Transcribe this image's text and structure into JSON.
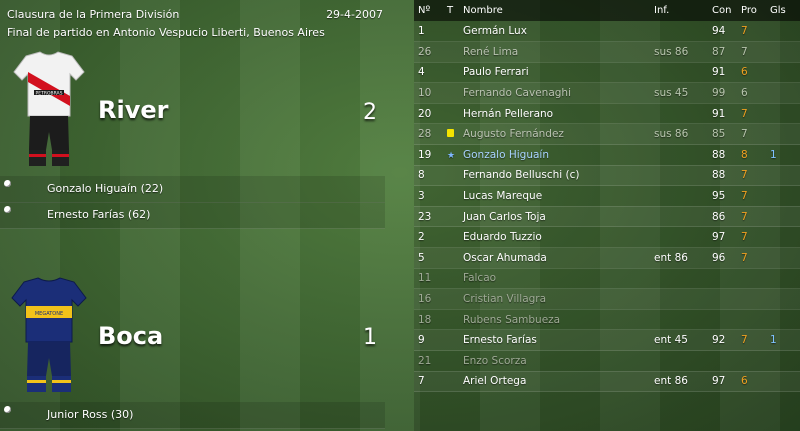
{
  "header": {
    "competition": "Clausura de la Primera División",
    "date": "29-4-2007",
    "venue_line": "Final de partido en Antonio Vespucio Liberti, Buenos Aires"
  },
  "home": {
    "name": "River",
    "score": "2",
    "scorers": [
      "Gonzalo Higuaín (22)",
      "Ernesto Farías (62)"
    ],
    "kit_sponsor": "PETROBRAS"
  },
  "away": {
    "name": "Boca",
    "score": "1",
    "scorers": [
      "Junior Ross (30)"
    ],
    "kit_sponsor": "MEGATONE"
  },
  "table": {
    "headers": [
      "Nº",
      "T",
      "Nombre",
      "Inf.",
      "Con",
      "Pro",
      "Gls"
    ],
    "rows": [
      {
        "num": "1",
        "t": "",
        "name": "Germán Lux",
        "inf": "",
        "con": "94",
        "pro": "7",
        "gls": "",
        "style": ""
      },
      {
        "num": "26",
        "t": "",
        "name": "René Lima",
        "inf": "sus 86",
        "con": "87",
        "pro": "7",
        "gls": "",
        "style": "sub"
      },
      {
        "num": "4",
        "t": "",
        "name": "Paulo Ferrari",
        "inf": "",
        "con": "91",
        "pro": "6",
        "gls": "",
        "style": ""
      },
      {
        "num": "10",
        "t": "",
        "name": "Fernando Cavenaghi",
        "inf": "sus 45",
        "con": "99",
        "pro": "6",
        "gls": "",
        "style": "sub"
      },
      {
        "num": "20",
        "t": "",
        "name": "Hernán Pellerano",
        "inf": "",
        "con": "91",
        "pro": "7",
        "gls": "",
        "style": ""
      },
      {
        "num": "28",
        "t": "yellow",
        "name": "Augusto Fernández",
        "inf": "sus 86",
        "con": "85",
        "pro": "7",
        "gls": "",
        "style": "sub"
      },
      {
        "num": "19",
        "t": "star",
        "name": "Gonzalo Higuaín",
        "inf": "",
        "con": "88",
        "pro": "8",
        "gls": "1",
        "style": "star"
      },
      {
        "num": "8",
        "t": "",
        "name": "Fernando Belluschi (c)",
        "inf": "",
        "con": "88",
        "pro": "7",
        "gls": "",
        "style": ""
      },
      {
        "num": "3",
        "t": "",
        "name": "Lucas Mareque",
        "inf": "",
        "con": "95",
        "pro": "7",
        "gls": "",
        "style": ""
      },
      {
        "num": "23",
        "t": "",
        "name": "Juan Carlos Toja",
        "inf": "",
        "con": "86",
        "pro": "7",
        "gls": "",
        "style": ""
      },
      {
        "num": "2",
        "t": "",
        "name": "Eduardo Tuzzio",
        "inf": "",
        "con": "97",
        "pro": "7",
        "gls": "",
        "style": ""
      },
      {
        "num": "5",
        "t": "",
        "name": "Oscar Ahumada",
        "inf": "ent 86",
        "con": "96",
        "pro": "7",
        "gls": "",
        "style": ""
      },
      {
        "num": "11",
        "t": "",
        "name": "Falcao",
        "inf": "",
        "con": "",
        "pro": "",
        "gls": "",
        "style": "unused"
      },
      {
        "num": "16",
        "t": "",
        "name": "Cristian Villagra",
        "inf": "",
        "con": "",
        "pro": "",
        "gls": "",
        "style": "unused"
      },
      {
        "num": "18",
        "t": "",
        "name": "Rubens Sambueza",
        "inf": "",
        "con": "",
        "pro": "",
        "gls": "",
        "style": "unused"
      },
      {
        "num": "9",
        "t": "",
        "name": "Ernesto Farías",
        "inf": "ent 45",
        "con": "92",
        "pro": "7",
        "gls": "1",
        "style": ""
      },
      {
        "num": "21",
        "t": "",
        "name": "Enzo Scorza",
        "inf": "",
        "con": "",
        "pro": "",
        "gls": "",
        "style": "unused"
      },
      {
        "num": "7",
        "t": "",
        "name": "Ariel Ortega",
        "inf": "ent 86",
        "con": "97",
        "pro": "6",
        "gls": "",
        "style": ""
      }
    ]
  }
}
